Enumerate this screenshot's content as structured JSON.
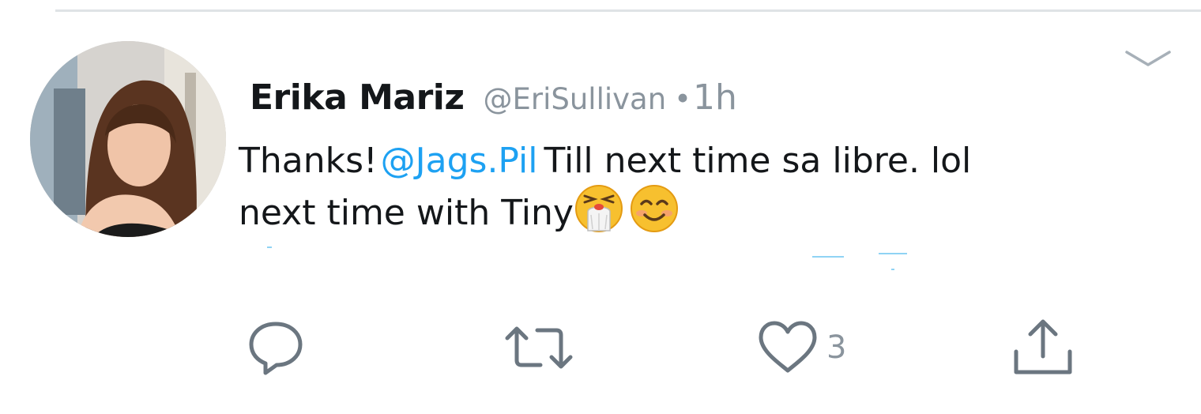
{
  "tweet": {
    "author_name": "Erika Mariz",
    "handle": "@EriSullivan",
    "separator": "•",
    "timestamp": "1h",
    "text_prefix": "Thanks!",
    "mention": "@Jags.Pil",
    "text_line1_rest": "Till next time sa libre. lol",
    "text_line2": "next time with Tiny",
    "emojis": [
      "sneezing-face",
      "smiling-face-with-smiling-eyes"
    ]
  },
  "actions": {
    "reply_icon": "reply-icon",
    "retweet_icon": "retweet-icon",
    "like_icon": "heart-icon",
    "like_count": "3",
    "share_icon": "share-icon"
  },
  "colors": {
    "text": "#14171a",
    "muted": "#8a949d",
    "link": "#1da1f2",
    "divider": "#dfe3e6"
  }
}
